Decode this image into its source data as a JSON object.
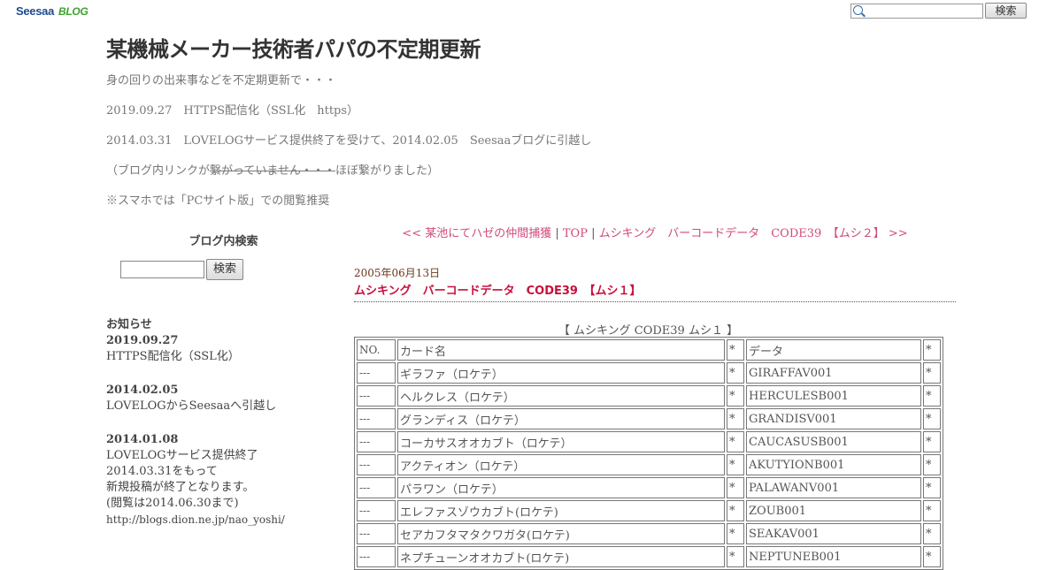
{
  "header": {
    "logo_seesaa": "Seesaa",
    "logo_blog": "BLOG",
    "search_placeholder": "",
    "search_button": "検索"
  },
  "blog": {
    "title": "某機械メーカー技術者パパの不定期更新",
    "desc1": "身の回りの出来事などを不定期更新で・・・",
    "desc2": "2019.09.27　HTTPS配信化（SSL化　https）",
    "desc3": "2014.03.31　LOVELOGサービス提供終了を受けて、2014.02.05　Seesaaブログに引越し",
    "desc4_prefix": "（ブログ内リンクが",
    "desc4_strike": "繋がっていません・・・",
    "desc4_suffix": "ほぼ繋がりました）",
    "desc5": "※スマホでは「PCサイト版」での閲覧推奨"
  },
  "sidebar": {
    "search_title": "ブログ内検索",
    "search_button": "検索",
    "news_heading": "お知らせ",
    "news": [
      {
        "date": "2019.09.27",
        "lines": [
          "HTTPS配信化（SSL化）"
        ]
      },
      {
        "date": "2014.02.05",
        "lines": [
          "LOVELOGからSeesaaへ引越し"
        ]
      },
      {
        "date": "2014.01.08",
        "lines": [
          "LOVELOGサービス提供終了",
          "2014.03.31をもって",
          "新規投稿が終了となります。",
          "(閲覧は2014.06.30まで)"
        ]
      }
    ],
    "news_url": "http://blogs.dion.ne.jp/nao_yoshi/"
  },
  "nav": {
    "prev": "<< 某池にてハゼの仲間捕獲",
    "sep": " | ",
    "top": "TOP",
    "next": "ムシキング　バーコードデータ　CODE39　【ムシ２】 >>"
  },
  "post": {
    "date": "2005年06月13日",
    "title": "ムシキング　バーコードデータ　CODE39　【ムシ１】",
    "caption": "【 ムシキング CODE39 ムシ１ 】",
    "table": {
      "header": [
        "NO.",
        "カード名",
        "*",
        "データ",
        "*"
      ],
      "rows": [
        [
          "---",
          "ギラファ（ロケテ）",
          "*",
          "GIRAFFAV001",
          "*"
        ],
        [
          "---",
          "ヘルクレス（ロケテ）",
          "*",
          "HERCULESB001",
          "*"
        ],
        [
          "---",
          "グランディス（ロケテ）",
          "*",
          "GRANDISV001",
          "*"
        ],
        [
          "---",
          "コーカサスオオカブト（ロケテ）",
          "*",
          "CAUCASUSB001",
          "*"
        ],
        [
          "---",
          "アクティオン（ロケテ）",
          "*",
          "AKUTYIONB001",
          "*"
        ],
        [
          "---",
          "パラワン（ロケテ）",
          "*",
          "PALAWANV001",
          "*"
        ],
        [
          "---",
          "エレファスゾウカブト(ロケテ)",
          "*",
          "ZOUB001",
          "*"
        ],
        [
          "---",
          "セアカフタマタクワガタ(ロケテ)",
          "*",
          "SEAKAV001",
          "*"
        ],
        [
          "---",
          "ネプチューンオオカブト(ロケテ)",
          "*",
          "NEPTUNEB001",
          "*"
        ]
      ]
    }
  }
}
